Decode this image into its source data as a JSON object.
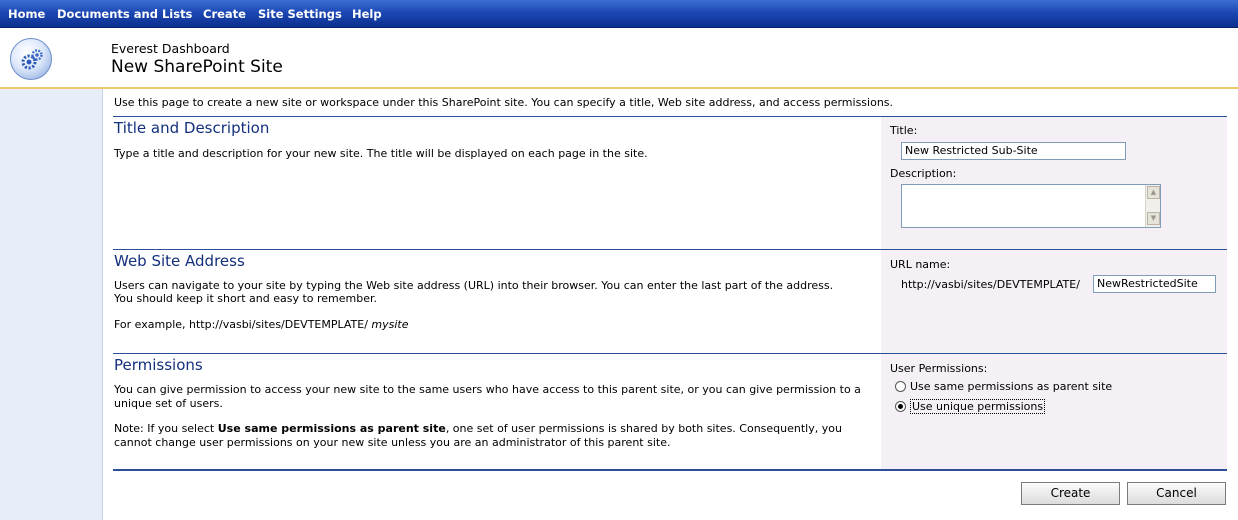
{
  "nav": {
    "home": "Home",
    "documents_and_lists": "Documents and Lists",
    "create": "Create",
    "site_settings": "Site Settings",
    "help": "Help"
  },
  "header": {
    "site_name": "Everest Dashboard",
    "page_title": "New SharePoint Site",
    "logo_icon": "sharepoint-gears-icon"
  },
  "intro": "Use this page to create a new site or workspace under this SharePoint site. You can specify a title, Web site address, and access permissions.",
  "title_section": {
    "heading": "Title and Description",
    "text": "Type a title and description for your new site. The title will be displayed on each page in the site.",
    "title_label": "Title:",
    "title_value": "New Restricted Sub-Site",
    "description_label": "Description:",
    "description_value": ""
  },
  "address_section": {
    "heading": "Web Site Address",
    "text_line1": "Users can navigate to your site by typing the Web site address (URL) into their browser. You can enter the last part of the address.",
    "text_line2": "You should keep it short and easy to remember.",
    "example_prefix": "For example, http://vasbi/sites/DEVTEMPLATE/",
    "example_suffix": "mysite",
    "url_label": "URL name:",
    "url_prefix": "http://vasbi/sites/DEVTEMPLATE/",
    "url_value": "NewRestrictedSite"
  },
  "permissions_section": {
    "heading": "Permissions",
    "text": "You can give permission to access your new site to the same users who have access to this parent site, or you can give permission to a unique set of users.",
    "note_prefix": "Note: If you select ",
    "note_bold": "Use same permissions as parent site",
    "note_suffix": ", one set of user permissions is shared by both sites. Consequently, you cannot change user permissions on your new site unless you are an administrator of this parent site.",
    "label": "User Permissions:",
    "option_same": "Use same permissions as parent site",
    "option_unique": "Use unique permissions",
    "selected": "unique"
  },
  "buttons": {
    "create": "Create",
    "cancel": "Cancel"
  }
}
